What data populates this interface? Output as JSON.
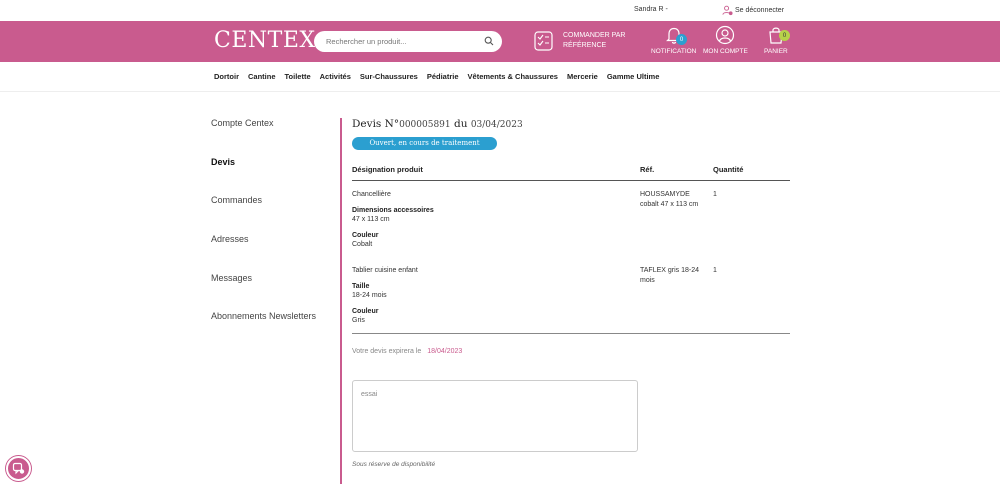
{
  "topbar": {
    "user": "Sandra R -",
    "logout": "Se déconnecter"
  },
  "header": {
    "logo": "CENTEX",
    "search_placeholder": "Rechercher un produit...",
    "order_ref_line1": "COMMANDER PAR",
    "order_ref_line2": "RÉFÉRENCE",
    "notification_label": "NOTIFICATION",
    "notification_count": "0",
    "account_label": "MON COMPTE",
    "cart_label": "PANIER",
    "cart_count": "0"
  },
  "nav": [
    "Dortoir",
    "Cantine",
    "Toilette",
    "Activités",
    "Sur-Chaussures",
    "Pédiatrie",
    "Vêtements & Chaussures",
    "Mercerie",
    "Gamme Ultime"
  ],
  "sidebar": [
    "Compte Centex",
    "Devis",
    "Commandes",
    "Adresses",
    "Messages",
    "Abonnements Newsletters"
  ],
  "quote": {
    "title_prefix": "Devis N°",
    "number": "000005891",
    "date_prefix": "du",
    "date": "03/04/2023",
    "status": "Ouvert, en cours de traitement",
    "col_designation": "Désignation produit",
    "col_ref": "Réf.",
    "col_qty": "Quantité",
    "items": [
      {
        "name": "Chancellière",
        "attr1_label": "Dimensions accessoires",
        "attr1_value": "47 x 113 cm",
        "attr2_label": "Couleur",
        "attr2_value": "Cobalt",
        "ref": "HOUSSAMYDE cobalt 47 x 113 cm",
        "qty": "1"
      },
      {
        "name": "Tablier cuisine enfant",
        "attr1_label": "Taille",
        "attr1_value": "18-24 mois",
        "attr2_label": "Couleur",
        "attr2_value": "Gris",
        "ref": "TAFLEX gris 18-24 mois",
        "qty": "1"
      }
    ],
    "expire_label": "Votre devis expirera le",
    "expire_date": "18/04/2023",
    "comment": "essai",
    "reserve": "Sous réserve de disponibilité"
  },
  "colors": {
    "brand": "#c95b8e",
    "status": "#2b9fd0",
    "cart_badge": "#b7d14a"
  }
}
